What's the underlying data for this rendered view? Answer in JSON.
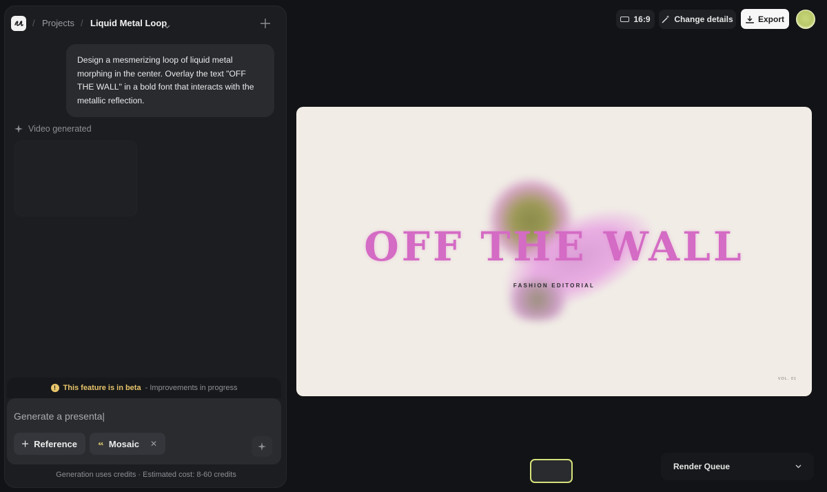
{
  "breadcrumb": {
    "separator": "/",
    "projects": "Projects",
    "current": "Liquid Metal Loop"
  },
  "chat": {
    "prompt": "Design a mesmerizing loop of liquid metal morphing in the center. Overlay the text \"OFF THE WALL\" in a bold font that interacts with the metallic reflection.",
    "status": "Video generated"
  },
  "composer": {
    "beta_strong": "This feature is in beta",
    "beta_rest": " - Improvements in progress",
    "input_value": "Generate a presenta|",
    "reference_label": "Reference",
    "mosaic_label": "Mosaic",
    "mosaic_remove": "✕",
    "cost_note": "Generation uses credits · Estimated cost: 8-60 credits"
  },
  "toolbar": {
    "aspect": "16:9",
    "change_details": "Change details",
    "export": "Export"
  },
  "canvas": {
    "title": "OFF THE WALL",
    "subtitle": "FASHION EDITORIAL",
    "volume": "VOL. 01"
  },
  "render_queue": {
    "label": "Render Queue"
  },
  "colors": {
    "accent": "#d7e27a",
    "beta": "#e7c46b",
    "title_pink": "#d46bc4",
    "canvas_bg": "#f1ede6"
  },
  "icons": [
    "logo-icon",
    "plus-icon",
    "chevron-down-icon",
    "sparkle-icon",
    "warning-icon",
    "aspect-ratio-icon",
    "magic-wand-icon",
    "download-icon",
    "mosaic-icon",
    "close-icon"
  ]
}
